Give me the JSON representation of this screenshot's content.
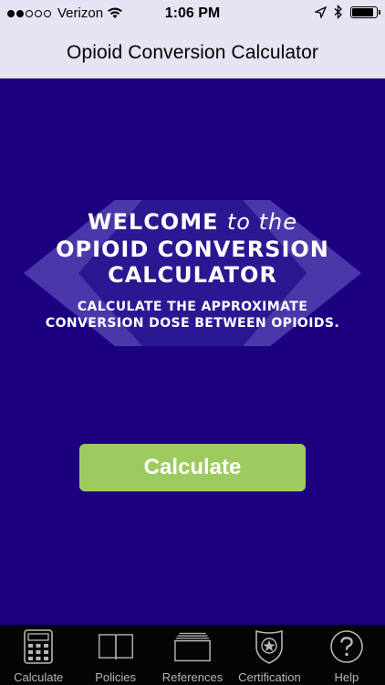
{
  "status_bar": {
    "carrier": "Verizon",
    "time": "1:06 PM"
  },
  "nav": {
    "title": "Opioid Conversion Calculator"
  },
  "welcome": {
    "line1": "WELCOME",
    "line1_suffix": "to the",
    "line2": "OPIOID CONVERSION",
    "line3": "CALCULATOR",
    "subtitle_line1": "CALCULATE THE APPROXIMATE",
    "subtitle_line2": "CONVERSION DOSE BETWEEN OPIOIDS."
  },
  "main": {
    "calculate_button": "Calculate"
  },
  "tabs": [
    {
      "label": "Calculate",
      "icon": "calculator-icon"
    },
    {
      "label": "Policies",
      "icon": "book-icon"
    },
    {
      "label": "References",
      "icon": "folder-stack-icon"
    },
    {
      "label": "Certification",
      "icon": "badge-icon"
    },
    {
      "label": "Help",
      "icon": "help-icon"
    }
  ],
  "colors": {
    "background": "#1c0080",
    "nav_background": "#e6e4f3",
    "button": "#9dcb5f",
    "tab_bar": "#050505"
  }
}
